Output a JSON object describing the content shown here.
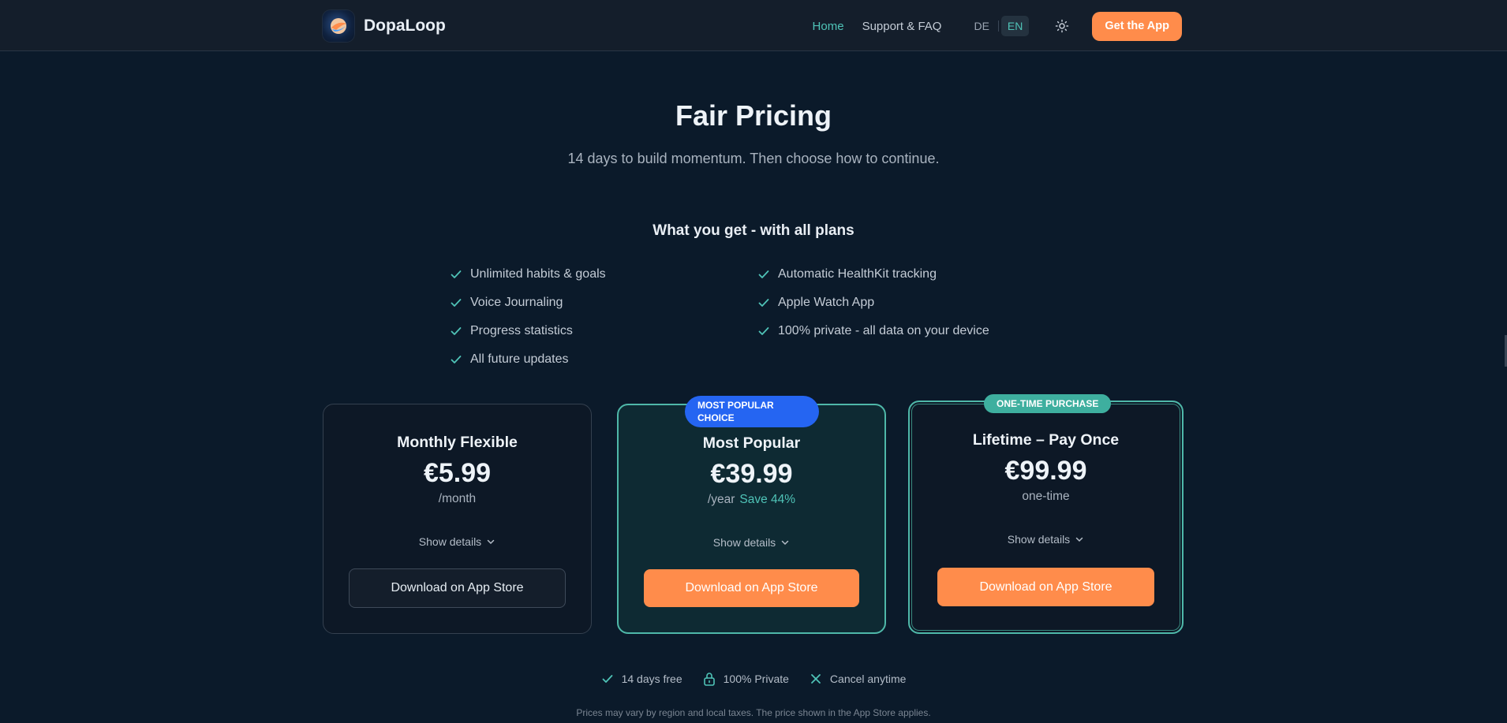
{
  "header": {
    "brand": "DopaLoop",
    "nav": {
      "home": "Home",
      "support": "Support & FAQ"
    },
    "lang": {
      "de": "DE",
      "en": "EN"
    },
    "cta": "Get the App"
  },
  "hero": {
    "title": "Fair Pricing",
    "subtitle": "14 days to build momentum. Then choose how to continue."
  },
  "features": {
    "title": "What you get - with all plans",
    "left": [
      "Unlimited habits & goals",
      "Voice Journaling",
      "Progress statistics",
      "All future updates"
    ],
    "right": [
      "Automatic HealthKit tracking",
      "Apple Watch App",
      "100% private - all data on your device"
    ]
  },
  "plans": [
    {
      "name": "Monthly Flexible",
      "price": "€5.99",
      "period": "/month",
      "details": "Show details",
      "button": "Download on App Store"
    },
    {
      "badge": "MOST POPULAR CHOICE",
      "name": "Most Popular",
      "price": "€39.99",
      "period": "/year",
      "save": "Save 44%",
      "details": "Show details",
      "button": "Download on App Store"
    },
    {
      "badge": "ONE-TIME PURCHASE",
      "name": "Lifetime – Pay Once",
      "price": "€99.99",
      "period": "one-time",
      "details": "Show details",
      "button": "Download on App Store"
    }
  ],
  "trust": {
    "free": "14 days free",
    "private": "100% Private",
    "cancel": "Cancel anytime"
  },
  "fineprint": "Prices may vary by region and local taxes. The price shown in the App Store applies.",
  "colors": {
    "accent": "#ff8c4b",
    "teal": "#4fc3b7",
    "blue": "#2565f2",
    "background": "#0b1a2a"
  },
  "icons": [
    "logo-icon",
    "sun-icon",
    "check-icon",
    "chevron-down-icon",
    "lock-icon",
    "close-icon"
  ]
}
